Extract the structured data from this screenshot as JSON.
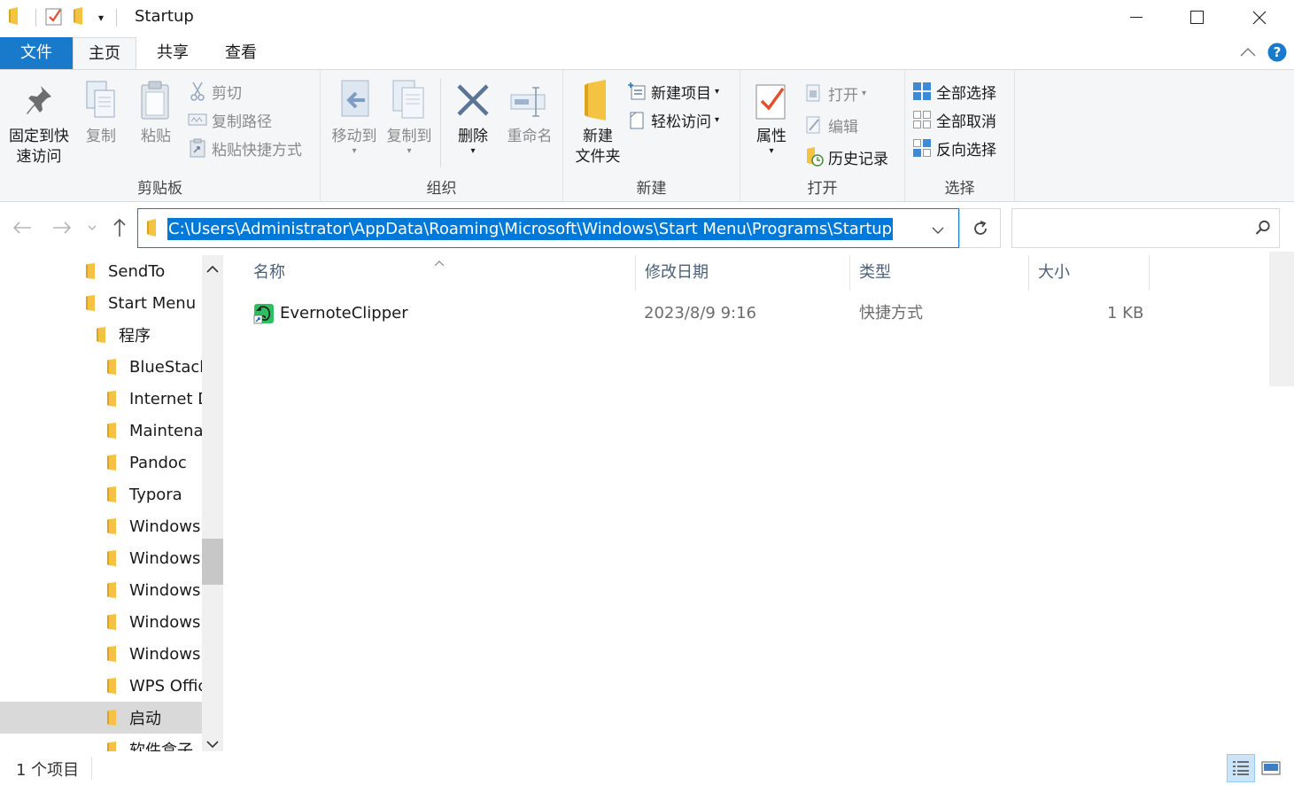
{
  "window": {
    "title": "Startup"
  },
  "ribbon_tabs": {
    "file": "文件",
    "home": "主页",
    "share": "共享",
    "view": "查看"
  },
  "ribbon": {
    "clipboard": {
      "label": "剪贴板",
      "pin_line1": "固定到快",
      "pin_line2": "速访问",
      "copy": "复制",
      "paste": "粘贴",
      "cut": "剪切",
      "copy_path": "复制路径",
      "paste_shortcut": "粘贴快捷方式"
    },
    "organize": {
      "label": "组织",
      "move_to": "移动到",
      "copy_to": "复制到",
      "delete": "删除",
      "rename": "重命名"
    },
    "new": {
      "label": "新建",
      "new_folder_line1": "新建",
      "new_folder_line2": "文件夹",
      "new_item": "新建项目",
      "easy_access": "轻松访问"
    },
    "open": {
      "label": "打开",
      "properties": "属性",
      "open": "打开",
      "edit": "编辑",
      "history": "历史记录"
    },
    "select": {
      "label": "选择",
      "select_all": "全部选择",
      "select_none": "全部取消",
      "invert": "反向选择"
    }
  },
  "address_bar": {
    "path": "C:\\Users\\Administrator\\AppData\\Roaming\\Microsoft\\Windows\\Start Menu\\Programs\\Startup"
  },
  "nav_tree": [
    {
      "label": "SendTo",
      "indent": 1,
      "selected": false
    },
    {
      "label": "Start Menu",
      "indent": 1,
      "selected": false
    },
    {
      "label": "程序",
      "indent": 2,
      "selected": false
    },
    {
      "label": "BlueStack",
      "indent": 3,
      "selected": false
    },
    {
      "label": "Internet D",
      "indent": 3,
      "selected": false
    },
    {
      "label": "Maintena",
      "indent": 3,
      "selected": false
    },
    {
      "label": "Pandoc",
      "indent": 3,
      "selected": false
    },
    {
      "label": "Typora",
      "indent": 3,
      "selected": false
    },
    {
      "label": "Windows",
      "indent": 3,
      "selected": false
    },
    {
      "label": "Windows",
      "indent": 3,
      "selected": false
    },
    {
      "label": "Windows",
      "indent": 3,
      "selected": false
    },
    {
      "label": "Windows",
      "indent": 3,
      "selected": false
    },
    {
      "label": "Windows",
      "indent": 3,
      "selected": false
    },
    {
      "label": "WPS Offic",
      "indent": 3,
      "selected": false
    },
    {
      "label": "启动",
      "indent": 3,
      "selected": true
    },
    {
      "label": "软件盒子",
      "indent": 3,
      "selected": false
    }
  ],
  "columns": {
    "name": "名称",
    "modified": "修改日期",
    "type": "类型",
    "size": "大小"
  },
  "files": [
    {
      "name": "EvernoteClipper",
      "modified": "2023/8/9 9:16",
      "type": "快捷方式",
      "size": "1 KB"
    }
  ],
  "status": {
    "item_count": "1 个项目"
  },
  "colors": {
    "accent": "#1979ca",
    "selection": "#0078d7",
    "folder": "#f5c342"
  }
}
